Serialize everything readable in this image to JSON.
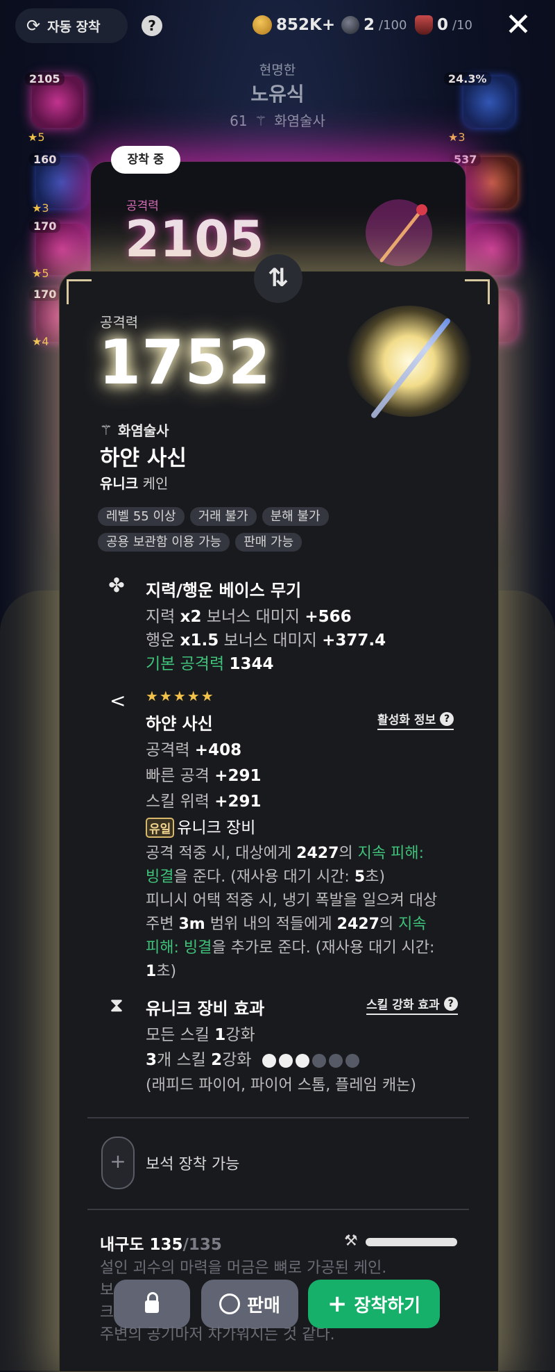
{
  "topbar": {
    "auto_equip_label": "자동 장착",
    "help": "?",
    "currencies": [
      {
        "icon": "gold-coin-icon",
        "value": "852K+",
        "max": ""
      },
      {
        "icon": "dark-orb-icon",
        "value": "2",
        "max": "/100"
      },
      {
        "icon": "demon-mask-icon",
        "value": "0",
        "max": "/10"
      }
    ],
    "close": "✕"
  },
  "character": {
    "title": "현명한",
    "name": "노유식",
    "level": "61",
    "class": "화염술사"
  },
  "side_slots_left": [
    {
      "num": "2105",
      "stars": "★5"
    },
    {
      "num": "160",
      "stars": "★3"
    },
    {
      "num": "170",
      "stars": "★5"
    },
    {
      "num": "170",
      "stars": "★4"
    }
  ],
  "side_slots_right": [
    {
      "num": "24.3%",
      "stars": "★3"
    },
    {
      "num": "537",
      "stars": ""
    }
  ],
  "equipped": {
    "tag": "장착 중",
    "atk_label": "공격력",
    "atk_value": "2105"
  },
  "swap_icon": "⇅",
  "item": {
    "atk_label": "공격력",
    "atk_value": "1752",
    "class": "화염술사",
    "name": "하얀 사신",
    "rarity": "유니크",
    "type": "케인",
    "tags": [
      "레벨 55 이상",
      "거래 불가",
      "분해 불가",
      "공용 보관함 이용 가능",
      "판매 가능"
    ],
    "base_weapon": {
      "title": "지력/행운 베이스 무기",
      "line1_stat": "지력",
      "line1_mult": "x2",
      "line1_text": "보너스 대미지",
      "line1_val": "+566",
      "line2_stat": "행운",
      "line2_mult": "x1.5",
      "line2_text": "보너스 대미지",
      "line2_val": "+377.4",
      "base_atk_label": "기본 공격력",
      "base_atk_val": "1344"
    },
    "set": {
      "chevron": "<",
      "stars": "★★★★★",
      "name": "하얀 사신",
      "info_link": "활성화 정보",
      "stats": [
        {
          "label": "공격력",
          "value": "+408"
        },
        {
          "label": "빠른 공격",
          "value": "+291"
        },
        {
          "label": "스킬 위력",
          "value": "+291"
        }
      ],
      "unique_badge": "유일",
      "unique_label": "유니크 장비",
      "effect1_a": "공격 적중 시, 대상에게",
      "effect1_num": "2427",
      "effect1_b": "의",
      "effect1_green1": "지속 피해:",
      "effect1_green2": "빙결",
      "effect1_c": "을 준다. (재사용 대기 시간:",
      "effect1_sec": "5",
      "effect1_d": "초)",
      "effect2_a": "피니시 어택 적중 시, 냉기 폭발을 일으켜 대상",
      "effect2_b": "주변",
      "effect2_range": "3m",
      "effect2_c": "범위 내의 적들에게",
      "effect2_num": "2427",
      "effect2_d": "의",
      "effect2_green1": "지속",
      "effect2_green2": "피해: 빙결",
      "effect2_e": "을 추가로 준다. (재사용 대기 시간:",
      "effect2_sec": "1",
      "effect2_f": "초)"
    },
    "unique_effect": {
      "title": "유니크 장비 효과",
      "link": "스킬 강화 효과",
      "line1_a": "모든 스킬",
      "line1_num": "1",
      "line1_b": "강화",
      "line2_num1": "3",
      "line2_a": "개 스킬",
      "line2_num2": "2",
      "line2_b": "강화",
      "dots_on": 3,
      "dots_total": 6,
      "skills": "(래피드 파이어, 파이어 스톰, 플레임 캐논)"
    },
    "gem": {
      "plus": "+",
      "label": "보석 장착 가능"
    },
    "durability": {
      "label": "내구도",
      "value": "135",
      "max": "/135",
      "icon": "hammer-icon",
      "fill": 1.0
    },
    "description": [
      "설인 괴수의 마력을 머금은 뼈로 가공된 케인.",
      "보",
      "크",
      "주변의 공기마저 차가워지는 것 같다."
    ]
  },
  "buttons": {
    "lock": "",
    "sell": "판매",
    "equip": "장착하기"
  }
}
